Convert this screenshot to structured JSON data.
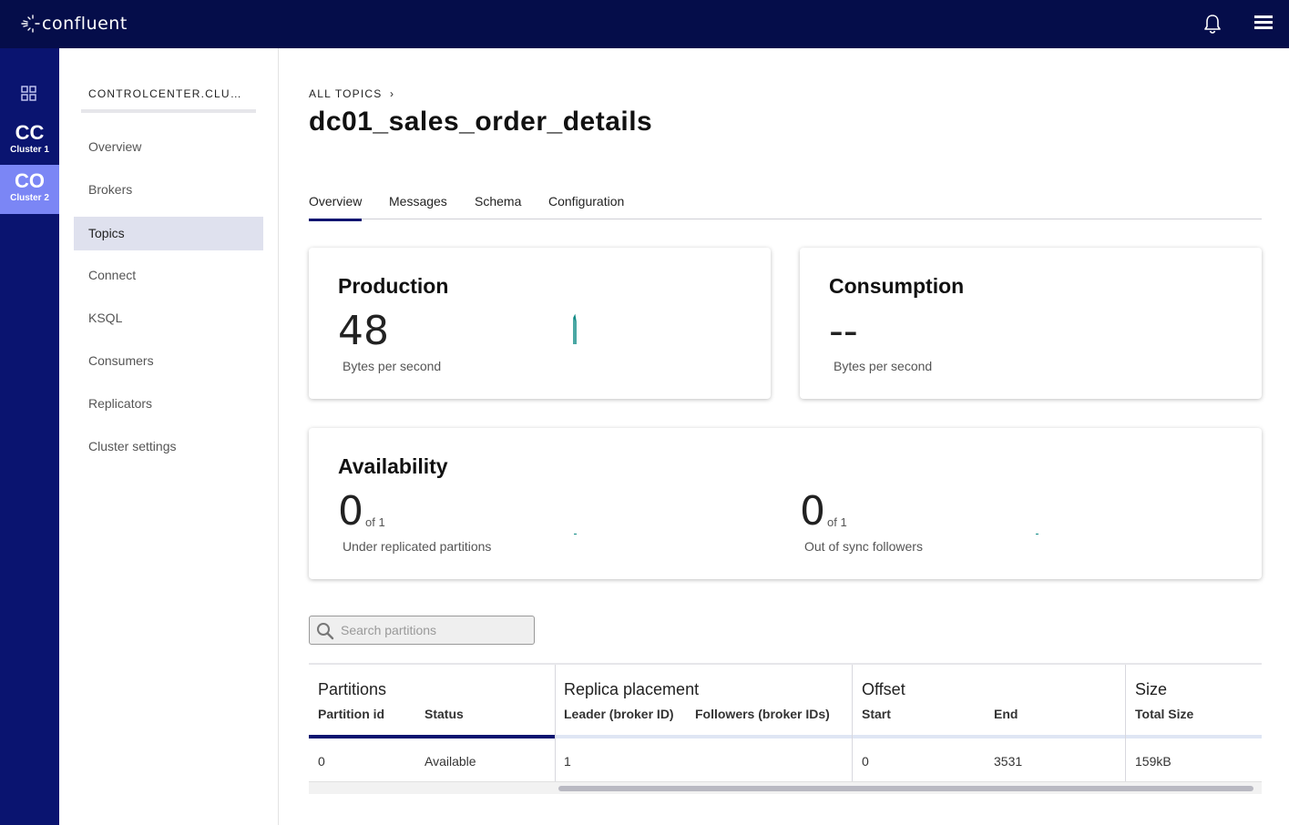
{
  "topbar": {
    "logo_text": "confluent"
  },
  "rail": {
    "clusters": [
      {
        "abbr": "CC",
        "name": "Cluster 1"
      },
      {
        "abbr": "CO",
        "name": "Cluster 2"
      }
    ]
  },
  "sidebar": {
    "cluster_title": "CONTROLCENTER.CLUSTER",
    "items": [
      {
        "label": "Overview"
      },
      {
        "label": "Brokers"
      },
      {
        "label": "Topics"
      },
      {
        "label": "Connect"
      },
      {
        "label": "KSQL"
      },
      {
        "label": "Consumers"
      },
      {
        "label": "Replicators"
      },
      {
        "label": "Cluster settings"
      }
    ],
    "active_item": "Topics"
  },
  "header": {
    "breadcrumb": "ALL TOPICS",
    "title": "dc01_sales_order_details"
  },
  "tabs": [
    {
      "label": "Overview"
    },
    {
      "label": "Messages"
    },
    {
      "label": "Schema"
    },
    {
      "label": "Configuration"
    }
  ],
  "active_tab": "Overview",
  "production": {
    "title": "Production",
    "value": "48",
    "unit": "Bytes per second"
  },
  "consumption": {
    "title": "Consumption",
    "value": "--",
    "unit": "Bytes per second"
  },
  "availability": {
    "title": "Availability",
    "under_replicated": {
      "value": "0",
      "of": "of 1",
      "label": "Under replicated partitions"
    },
    "out_of_sync": {
      "value": "0",
      "of": "of 1",
      "label": "Out of sync followers"
    }
  },
  "search": {
    "placeholder": "Search partitions",
    "value": ""
  },
  "partitions_table": {
    "groups": {
      "partitions": {
        "title": "Partitions",
        "columns": [
          "Partition id",
          "Status"
        ]
      },
      "replica": {
        "title": "Replica placement",
        "columns": [
          "Leader (broker ID)",
          "Followers (broker IDs)"
        ]
      },
      "offset": {
        "title": "Offset",
        "columns": [
          "Start",
          "End"
        ]
      },
      "size": {
        "title": "Size",
        "columns": [
          "Total Size"
        ]
      }
    },
    "rows": [
      {
        "partition_id": "0",
        "status": "Available",
        "leader": "1",
        "followers": "",
        "start": "0",
        "end": "3531",
        "total_size": "159kB"
      }
    ]
  },
  "colors": {
    "topbar": "#050d4a",
    "rail": "#0a1470",
    "rail_active": "#7b86f5",
    "nav_active": "#dfe1ee",
    "sparkline": "#0f8a85"
  }
}
